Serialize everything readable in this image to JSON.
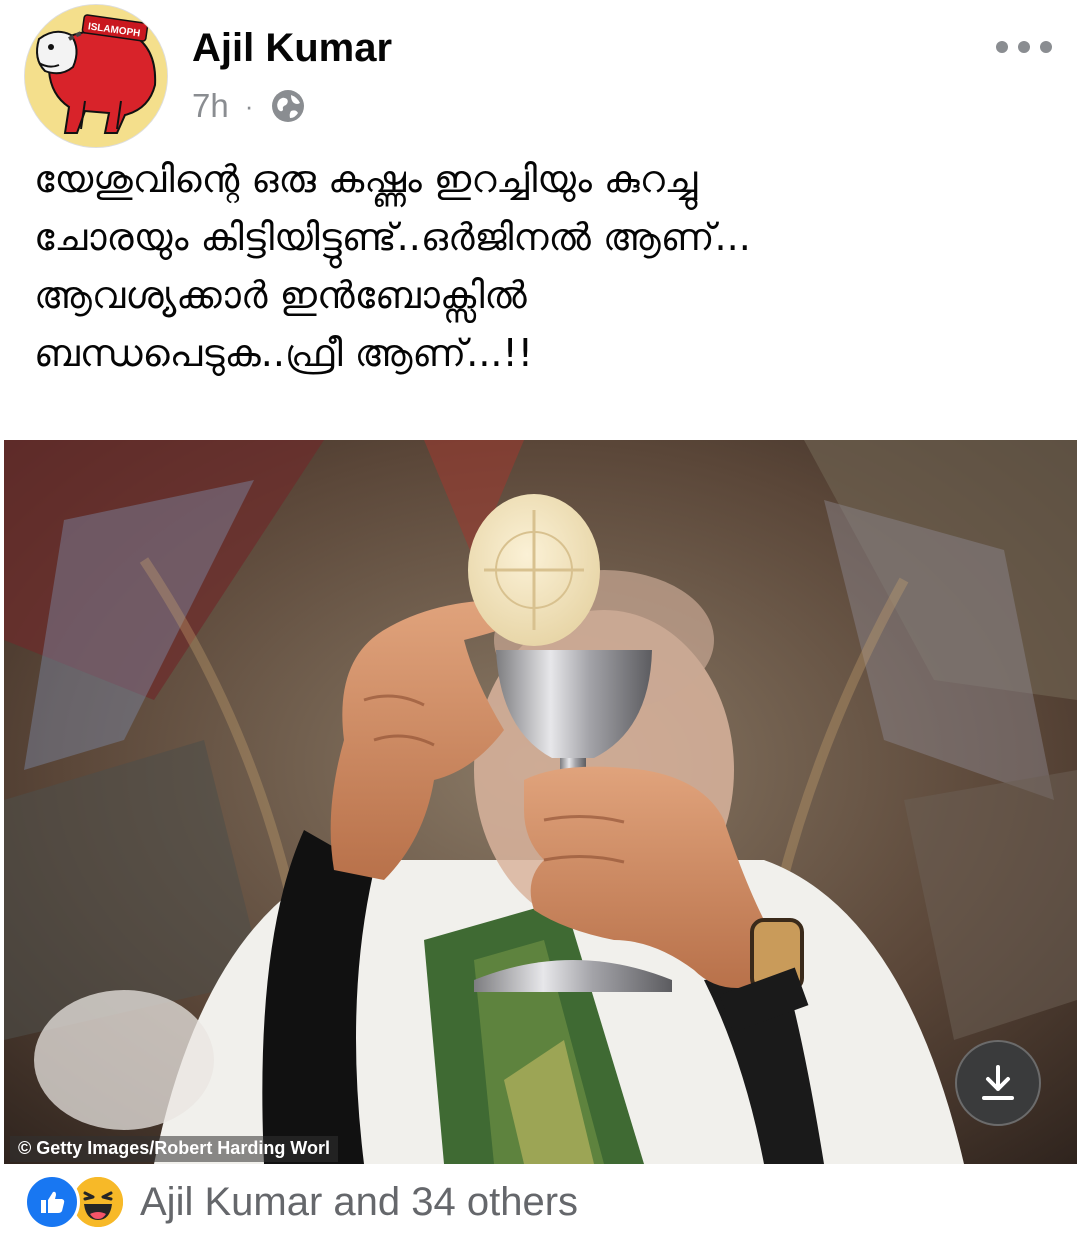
{
  "post": {
    "author": {
      "name": "Ajil Kumar",
      "avatar_badge_text": "ISLAMOPH"
    },
    "timestamp": "7h",
    "separator": "·",
    "audience_icon": "globe-icon",
    "text": "യേശുവിന്റെ ഒരു കഷ്ണം ഇറച്ചിയും കുറച്ചു\nചോരയും കിട്ടിയിട്ടുണ്ട്..ഒർജിനൽ ആണ്...\nആവശ്യക്കാർ ഇൻബോക്സിൽ\nബന്ധപെടുക..ഫ്രീ ആണ്...!!",
    "photo": {
      "credit": "© Getty Images/Robert Harding Worl",
      "download_icon": "download-icon"
    },
    "reactions": {
      "icons": [
        "like-icon",
        "haha-icon"
      ],
      "summary": "Ajil Kumar and 34 others"
    }
  },
  "colors": {
    "text_primary": "#050505",
    "text_secondary": "#65676b",
    "meta_gray": "#8a8d91",
    "like_blue": "#1877f2",
    "haha_yellow": "#f7b928"
  }
}
